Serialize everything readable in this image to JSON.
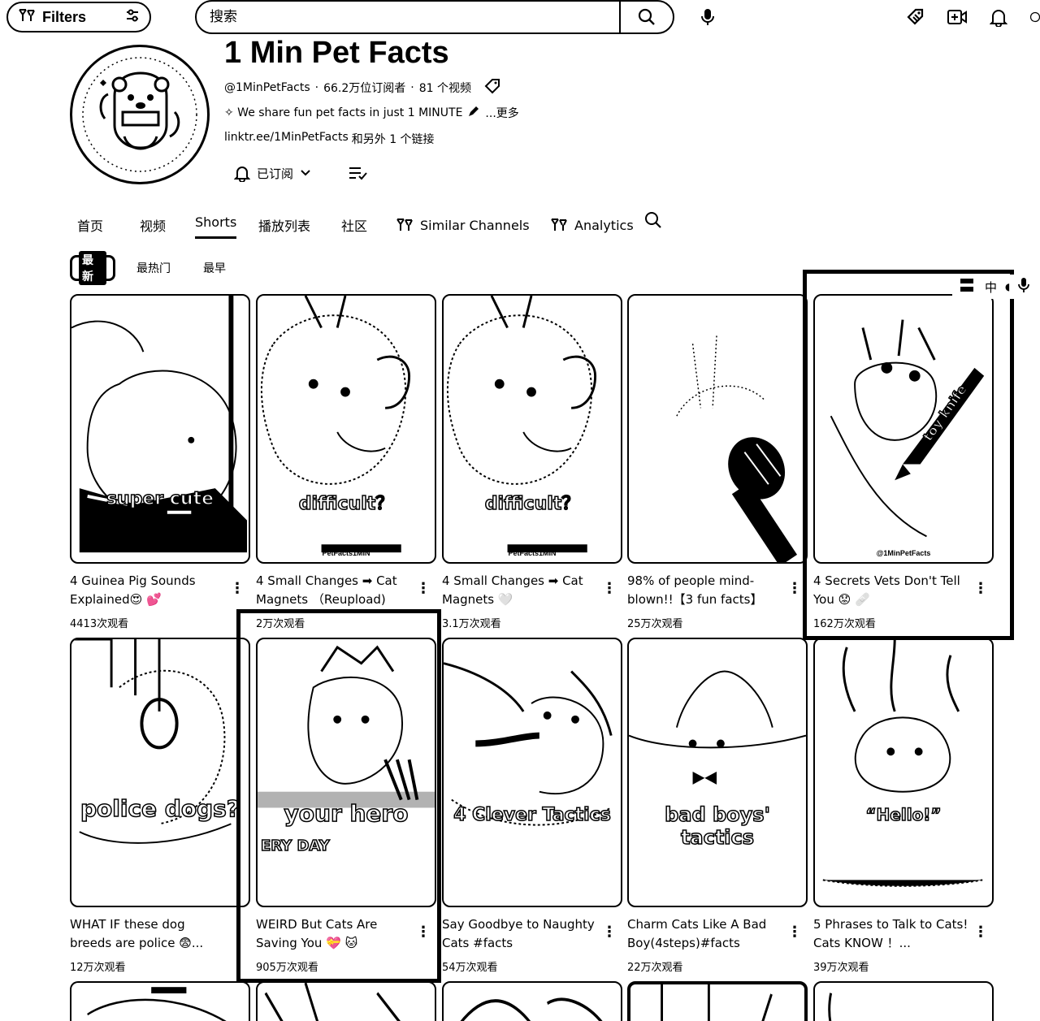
{
  "filters": {
    "label": "Filters"
  },
  "search": {
    "placeholder": "搜索"
  },
  "channel": {
    "title": "1 Min Pet Facts",
    "handle": "@1MinPetFacts",
    "subscribers": "66.2万位订阅者",
    "videos": "81 个视频",
    "description": "✧ We share fun pet facts in just 1 MINUTE",
    "more": "...更多",
    "link": "linktr.ee/1MinPetFacts",
    "link_extra": "和另外 1 个链接",
    "subscribed_label": "已订阅"
  },
  "tabs": [
    {
      "label": "首页"
    },
    {
      "label": "视频"
    },
    {
      "label": "Shorts"
    },
    {
      "label": "播放列表"
    },
    {
      "label": "社区"
    },
    {
      "label": "Similar Channels"
    },
    {
      "label": "Analytics"
    }
  ],
  "chips": [
    {
      "label": "最新"
    },
    {
      "label": "最热门"
    },
    {
      "label": "最早"
    }
  ],
  "ime": {
    "label": "中"
  },
  "shorts": [
    {
      "title": "4 Guinea Pig Sounds Explained😍 💕",
      "views": "4413次观看",
      "overlay": "super cute"
    },
    {
      "title": "4 Small Changes ➡ Cat Magnets （Reupload)",
      "views": "2万次观看",
      "overlay": "difficult？",
      "watermark": "PetFacts1MIN"
    },
    {
      "title": "4 Small Changes ➡ Cat Magnets 🤍",
      "views": "3.1万次观看",
      "overlay": "difficult？",
      "watermark": "PetFacts1MIN"
    },
    {
      "title": "98% of people mind-blown!!【3 fun facts】",
      "views": "25万次观看",
      "overlay": ""
    },
    {
      "title": "4 Secrets Vets Don't Tell You 😟 🩹",
      "views": "162万次观看",
      "overlay": "toy knife",
      "watermark": "@1MinPetFacts"
    },
    {
      "title": "WHAT IF these dog breeds are police 😨...",
      "views": "12万次观看",
      "overlay": "police dogs?"
    },
    {
      "title": "WEIRD But Cats Are Saving You 💝 🐱",
      "views": "905万次观看",
      "overlay": "your hero",
      "sub_overlay": "ERY DAY"
    },
    {
      "title": "Say Goodbye to Naughty Cats #facts",
      "views": "54万次观看",
      "overlay": "4 Clever Tactics"
    },
    {
      "title": "Charm Cats Like A Bad Boy(4steps)#facts",
      "views": "22万次观看",
      "overlay": "bad boys' tactics"
    },
    {
      "title": "5 Phrases to Talk to Cats! Cats KNOW ！...",
      "views": "39万次观看",
      "overlay": "“Hello!”"
    }
  ],
  "colors": {
    "ink": "#000000",
    "paper": "#ffffff"
  }
}
